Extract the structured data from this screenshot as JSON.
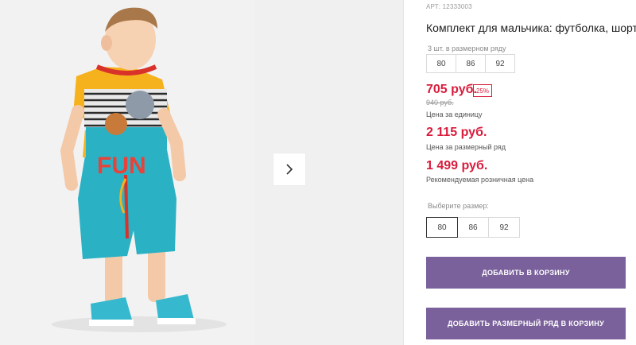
{
  "product": {
    "article": "АРТ: 12333003",
    "title": "Комплект для мальчика: футболка, шорты"
  },
  "pack": {
    "label": "3 шт. в размерном ряду",
    "sizes": [
      "80",
      "86",
      "92"
    ]
  },
  "pricing": {
    "unit_price": "705 руб.",
    "discount": "25%",
    "old_price": "940 руб.",
    "unit_label": "Цена за единицу",
    "pack_price": "2 115 руб.",
    "pack_label": "Цена за размерный ряд",
    "retail_price": "1 499 руб.",
    "retail_label": "Рекомендуемая розничная цена"
  },
  "size_select": {
    "label": "Выберите размер:",
    "options": [
      "80",
      "86",
      "92"
    ],
    "selected": "80"
  },
  "buttons": {
    "add_to_cart": "ДОБАВИТЬ В КОРЗИНУ",
    "add_pack_to_cart": "ДОБАВИТЬ РАЗМЕРНЫЙ РЯД В КОРЗИНУ"
  },
  "photo": {
    "shirt_print": "FUN"
  },
  "colors": {
    "price_red": "#d81c3c",
    "button_purple": "#7a619b"
  },
  "icons": {
    "next": "chevron-right-icon"
  }
}
